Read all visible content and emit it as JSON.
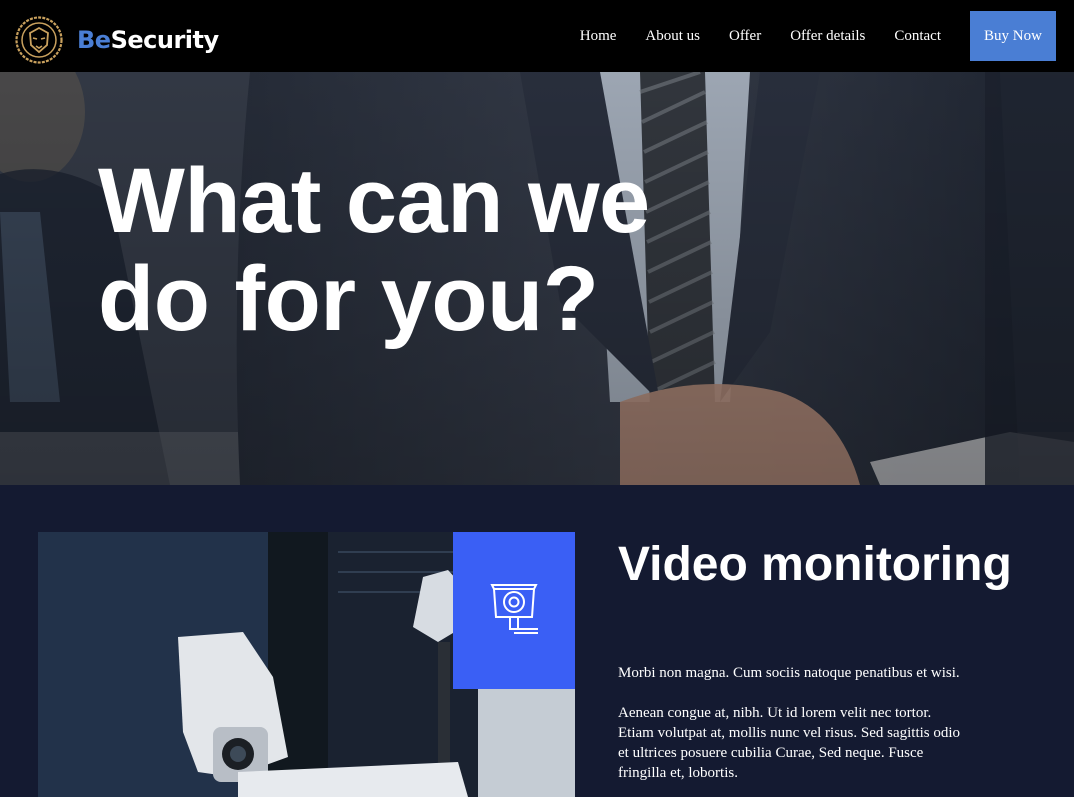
{
  "brand": {
    "prefix": "Be",
    "name": "Security",
    "accent": "#4a7ed4"
  },
  "nav": {
    "items": [
      {
        "label": "Home"
      },
      {
        "label": "About us"
      },
      {
        "label": "Offer"
      },
      {
        "label": "Offer details"
      },
      {
        "label": "Contact"
      }
    ],
    "cta_label": "Buy Now"
  },
  "hero": {
    "title": "What can we do for you?"
  },
  "service": {
    "icon": "security-camera-icon",
    "title": "Video monitoring",
    "paragraphs": [
      "Morbi non magna. Cum sociis natoque penatibus et wisi.",
      "Aenean congue at, nibh. Ut id lorem velit nec tortor. Etiam volutpat at, mollis nunc vel risus. Sed sagittis odio et ultrices posuere cubilia Curae, Sed neque. Fusce fringilla et, lobortis."
    ],
    "accent": "#3a5ff5"
  },
  "colors": {
    "navbar": "#000000",
    "section_bg": "#141a31"
  }
}
